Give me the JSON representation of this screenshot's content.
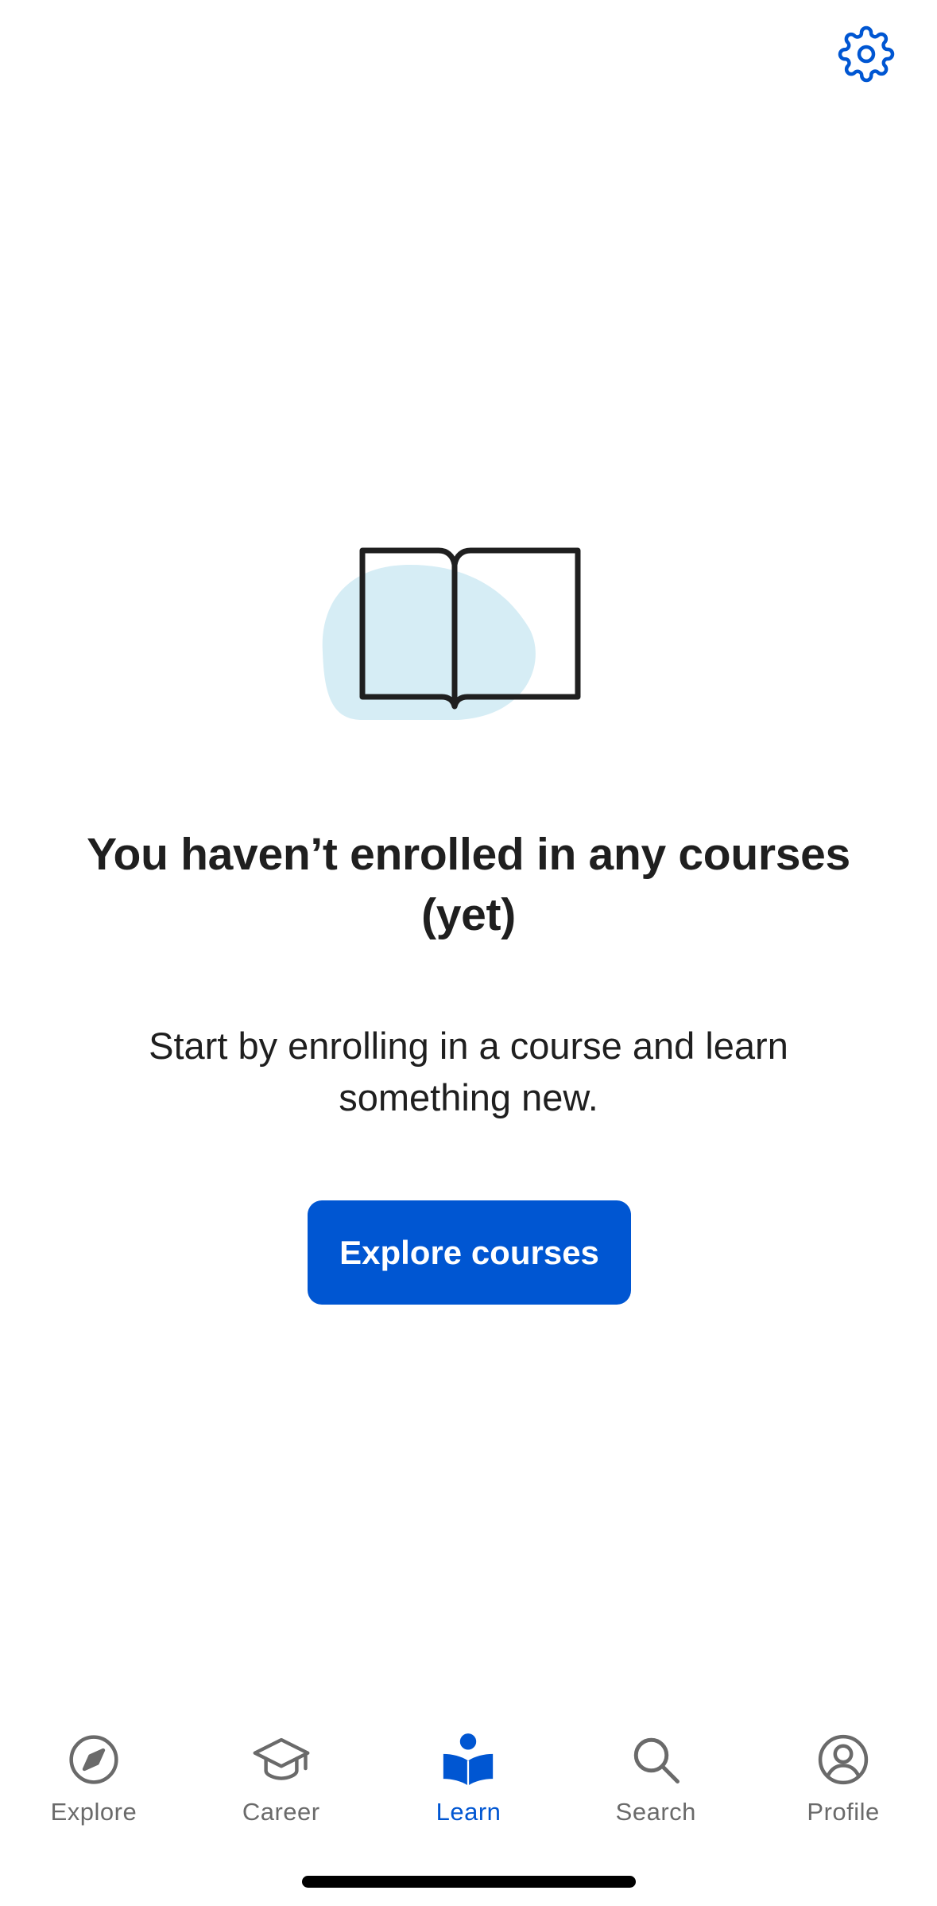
{
  "header": {
    "settings_icon": "gear-icon"
  },
  "empty_state": {
    "illustration_icon": "open-book-icon",
    "title": "You haven’t enrolled in any courses (yet)",
    "subtitle": "Start by enrolling in a course and learn something new.",
    "button_label": "Explore courses"
  },
  "tab_bar": {
    "items": [
      {
        "label": "Explore",
        "icon": "compass-icon",
        "active": false
      },
      {
        "label": "Career",
        "icon": "graduation-cap-icon",
        "active": false
      },
      {
        "label": "Learn",
        "icon": "reader-book-icon",
        "active": true
      },
      {
        "label": "Search",
        "icon": "search-icon",
        "active": false
      },
      {
        "label": "Profile",
        "icon": "profile-icon",
        "active": false
      }
    ]
  },
  "colors": {
    "accent": "#0056d2",
    "text": "#1f1f1f",
    "inactive_tab": "#6a6a6a",
    "illustration_blob": "#d6edf5",
    "background": "#ffffff"
  }
}
